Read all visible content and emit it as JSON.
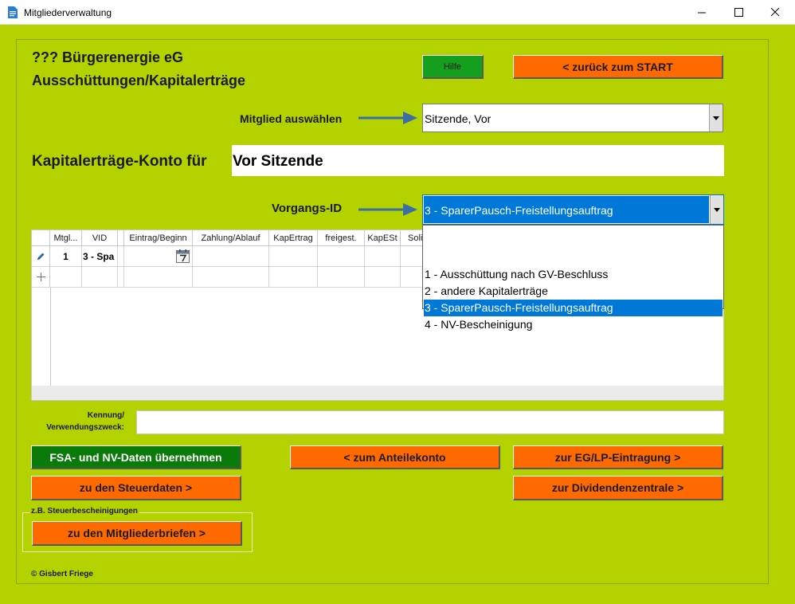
{
  "window": {
    "title": "Mitgliederverwaltung"
  },
  "header": {
    "org_name": "??? Bürgerenergie eG",
    "subtitle": "Ausschüttungen/Kapitalerträge",
    "help_label": "Hilfe",
    "back_label": "<  zurück zum START"
  },
  "member_select": {
    "label": "Mitglied auswählen",
    "value": "Sitzende, Vor"
  },
  "account": {
    "label": "Kapitalerträge-Konto für",
    "value": "Vor Sitzende"
  },
  "vorgang": {
    "label": "Vorgangs-ID",
    "value": "3 - SparerPausch-Freistellungsauftrag",
    "options": [
      "1 - Ausschüttung nach GV-Beschluss",
      "2 - andere Kapitalerträge",
      "3 - SparerPausch-Freistellungsauftrag",
      "4 - NV-Bescheinigung"
    ],
    "selected_index": 2
  },
  "grid": {
    "columns": [
      "Mtgl...",
      "VID",
      "Eintrag/Beginn",
      "Zahlung/Ablauf",
      "KapErtrag",
      "freigest.",
      "KapESt",
      "Soli"
    ],
    "rows": [
      {
        "cells": [
          "1",
          "3 - Spa",
          "",
          "",
          "",
          "",
          "",
          ""
        ]
      }
    ]
  },
  "kennung": {
    "label_line1": "Kennung/",
    "label_line2": "Verwendungszweck:",
    "value": ""
  },
  "buttons": {
    "fsa_nv": "FSA- und NV-Daten  übernehmen",
    "anteilekonto": "<  zum Anteilekonto",
    "eg_lp": "zur EG/LP-Eintragung  >",
    "steuerdaten": "zu den Steuerdaten  >",
    "dividenden": "zur Dividendenzentrale  >",
    "mitgliederbriefe": "zu den Mitgliederbriefen  >"
  },
  "group": {
    "caption": "z.B. Steuerbescheinigungen"
  },
  "footer": {
    "copyright": "© Gisbert Friege"
  },
  "colors": {
    "background": "#b4d200",
    "orange_button": "#ff6a00",
    "green_button": "#0a7a0a",
    "help_button": "#14a01e",
    "selection": "#0078d7",
    "arrow": "#3a6ea5"
  }
}
